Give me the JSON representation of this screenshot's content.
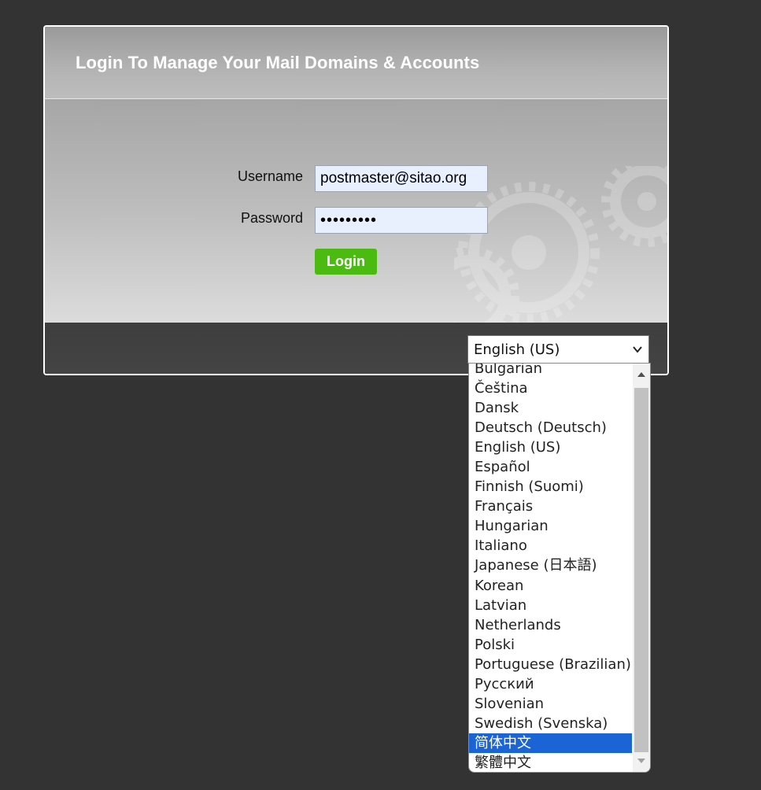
{
  "panel": {
    "title": "Login To Manage Your Mail Domains & Accounts"
  },
  "form": {
    "username_label": "Username",
    "username_value": "postmaster@sitao.org",
    "password_label": "Password",
    "password_value": "•••••••••",
    "login_label": "Login"
  },
  "language": {
    "selected": "English (US)",
    "options": [
      "Bulgarian",
      "Čeština",
      "Dansk",
      "Deutsch (Deutsch)",
      "English (US)",
      "Español",
      "Finnish (Suomi)",
      "Français",
      "Hungarian",
      "Italiano",
      "Japanese (日本語)",
      "Korean",
      "Latvian",
      "Netherlands",
      "Polski",
      "Portuguese (Brazilian)",
      "Русский",
      "Slovenian",
      "Swedish (Svenska)",
      "简体中文",
      "繁體中文"
    ],
    "highlighted_option": "简体中文"
  },
  "colors": {
    "page_background": "#333333",
    "login_button": "#4bbb12",
    "highlight": "#1a64d6",
    "field_background": "#e8f0fe"
  },
  "icons": {
    "select_chevron": "chevron-down-icon",
    "scroll_up": "scroll-up-arrow-icon",
    "scroll_down": "scroll-down-arrow-icon",
    "background_art": "gears-icon"
  }
}
